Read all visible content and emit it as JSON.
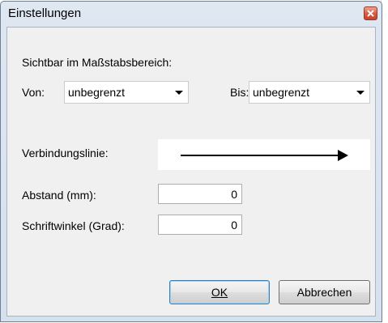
{
  "window": {
    "title": "Einstellungen"
  },
  "scale_range": {
    "heading": "Sichtbar im Maßstabsbereich:",
    "from_label": "Von:",
    "from_value": "unbegrenzt",
    "to_label": "Bis:",
    "to_value": "unbegrenzt"
  },
  "connection_line": {
    "label": "Verbindungslinie:",
    "icon": "arrow-right-line"
  },
  "distance": {
    "label": "Abstand (mm):",
    "value": "0"
  },
  "font_angle": {
    "label": "Schriftwinkel (Grad):",
    "value": "0"
  },
  "buttons": {
    "ok": "OK",
    "cancel": "Abbrechen"
  },
  "colors": {
    "close_button": "#d9573c",
    "title_bar": "#dfe7f1",
    "client_bg": "#f0f0f0"
  }
}
